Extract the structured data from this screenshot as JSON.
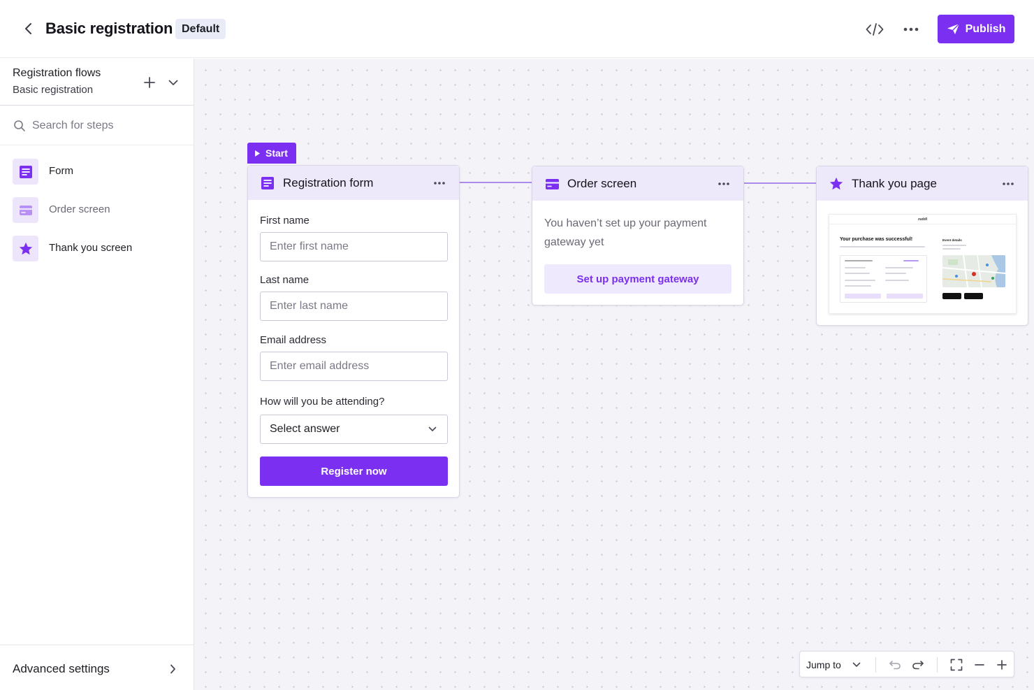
{
  "header": {
    "title": "Basic registration",
    "badge": "Default",
    "publish_label": "Publish"
  },
  "sidebar": {
    "flows_title": "Registration flows",
    "flows_subtitle": "Basic registration",
    "search_placeholder": "Search for steps",
    "steps": [
      {
        "label": "Form",
        "icon": "form-icon"
      },
      {
        "label": "Order screen",
        "icon": "card-icon"
      },
      {
        "label": "Thank you screen",
        "icon": "star-icon"
      }
    ],
    "advanced_label": "Advanced settings"
  },
  "canvas": {
    "start_label": "Start",
    "registration_card": {
      "title": "Registration form",
      "fields": [
        {
          "label": "First name",
          "placeholder": "Enter first name"
        },
        {
          "label": "Last name",
          "placeholder": "Enter last name"
        },
        {
          "label": "Email address",
          "placeholder": "Enter email address"
        }
      ],
      "question_label": "How will you be attending?",
      "select_value": "Select answer",
      "submit_label": "Register now"
    },
    "order_card": {
      "title": "Order screen",
      "message": "You haven’t set up your payment gateway yet",
      "action_label": "Set up payment gateway"
    },
    "thankyou_card": {
      "title": "Thank you page",
      "preview": {
        "logo": "zuddl",
        "heading": "Your purchase was successful!",
        "event_heading": "Event details"
      }
    }
  },
  "toolbar": {
    "jump_label": "Jump to"
  },
  "colors": {
    "accent": "#7b2ff0",
    "accent_light": "#eee8fb",
    "canvas_bg": "#f4f3f8"
  }
}
